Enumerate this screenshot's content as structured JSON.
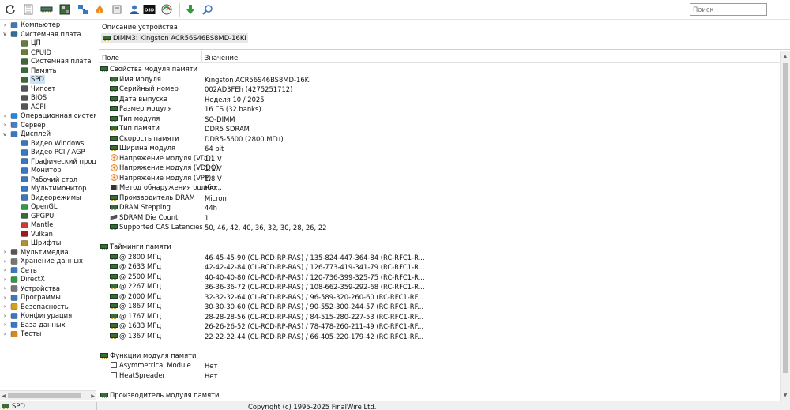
{
  "toolbar": {
    "search_placeholder": "Поиск",
    "icons": [
      "refresh-icon",
      "report-icon",
      "chip-icon",
      "motherboard-icon",
      "flame-icon",
      "network-icon",
      "user-icon",
      "osd-icon",
      "gauge-icon",
      "download-icon",
      "search-icon"
    ]
  },
  "tree": [
    {
      "label": "Компьютер",
      "level": 0,
      "expander": "›",
      "icon": "computer-icon",
      "color": "#3b78c4"
    },
    {
      "label": "Системная плата",
      "level": 0,
      "expander": "⌄",
      "icon": "motherboard-icon",
      "color": "#2f6f9f"
    },
    {
      "label": "ЦП",
      "level": 1,
      "icon": "cpu-icon",
      "color": "#6a7d3a"
    },
    {
      "label": "CPUID",
      "level": 1,
      "icon": "cpuid-icon",
      "color": "#6a7d3a"
    },
    {
      "label": "Системная плата",
      "level": 1,
      "icon": "motherboard-icon",
      "color": "#3a6b3a"
    },
    {
      "label": "Память",
      "level": 1,
      "icon": "memory-icon",
      "color": "#3a6b3a"
    },
    {
      "label": "SPD",
      "level": 1,
      "icon": "chip-icon",
      "color": "#3a6b3a",
      "selected": true
    },
    {
      "label": "Чипсет",
      "level": 1,
      "icon": "chipset-icon",
      "color": "#555"
    },
    {
      "label": "BIOS",
      "level": 1,
      "icon": "bios-icon",
      "color": "#555"
    },
    {
      "label": "ACPI",
      "level": 1,
      "icon": "acpi-icon",
      "color": "#555"
    },
    {
      "label": "Операционная система",
      "level": 0,
      "expander": "›",
      "icon": "windows-icon",
      "color": "#1e88e5"
    },
    {
      "label": "Сервер",
      "level": 0,
      "expander": "›",
      "icon": "server-icon",
      "color": "#4a7fbf"
    },
    {
      "label": "Дисплей",
      "level": 0,
      "expander": "⌄",
      "icon": "display-icon",
      "color": "#3b78c4"
    },
    {
      "label": "Видео Windows",
      "level": 1,
      "icon": "video-windows-icon",
      "color": "#3b78c4"
    },
    {
      "label": "Видео PCI / AGP",
      "level": 1,
      "icon": "video-pci-icon",
      "color": "#3b78c4"
    },
    {
      "label": "Графический процессо",
      "level": 1,
      "icon": "gpu-icon",
      "color": "#3b78c4"
    },
    {
      "label": "Монитор",
      "level": 1,
      "icon": "monitor-icon",
      "color": "#3b78c4"
    },
    {
      "label": "Рабочий стол",
      "level": 1,
      "icon": "desktop-icon",
      "color": "#3b78c4"
    },
    {
      "label": "Мультимонитор",
      "level": 1,
      "icon": "multimonitor-icon",
      "color": "#3b78c4"
    },
    {
      "label": "Видеорежимы",
      "level": 1,
      "icon": "videomodes-icon",
      "color": "#3b78c4"
    },
    {
      "label": "OpenGL",
      "level": 1,
      "icon": "opengl-icon",
      "color": "#2e9e3e"
    },
    {
      "label": "GPGPU",
      "level": 1,
      "icon": "gpgpu-icon",
      "color": "#3a6b3a"
    },
    {
      "label": "Mantle",
      "level": 1,
      "icon": "mantle-icon",
      "color": "#d33a2c"
    },
    {
      "label": "Vulkan",
      "level": 1,
      "icon": "vulkan-icon",
      "color": "#a01c1c"
    },
    {
      "label": "Шрифты",
      "level": 1,
      "icon": "fonts-icon",
      "color": "#b89020"
    },
    {
      "label": "Мультимедиа",
      "level": 0,
      "expander": "›",
      "icon": "multimedia-icon",
      "color": "#555"
    },
    {
      "label": "Хранение данных",
      "level": 0,
      "expander": "›",
      "icon": "storage-icon",
      "color": "#777"
    },
    {
      "label": "Сеть",
      "level": 0,
      "expander": "›",
      "icon": "network-icon",
      "color": "#3b78c4"
    },
    {
      "label": "DirectX",
      "level": 0,
      "expander": "›",
      "icon": "directx-icon",
      "color": "#2e9e3e"
    },
    {
      "label": "Устройства",
      "level": 0,
      "expander": "›",
      "icon": "devices-icon",
      "color": "#777"
    },
    {
      "label": "Программы",
      "level": 0,
      "expander": "›",
      "icon": "programs-icon",
      "color": "#3b78c4"
    },
    {
      "label": "Безопасность",
      "level": 0,
      "expander": "›",
      "icon": "security-icon",
      "color": "#d3a020"
    },
    {
      "label": "Конфигурация",
      "level": 0,
      "expander": "›",
      "icon": "configuration-icon",
      "color": "#3b78c4"
    },
    {
      "label": "База данных",
      "level": 0,
      "expander": "›",
      "icon": "database-icon",
      "color": "#3b78c4"
    },
    {
      "label": "Тесты",
      "level": 0,
      "expander": "›",
      "icon": "tests-icon",
      "color": "#d38a20"
    }
  ],
  "description": {
    "header": "Описание устройства",
    "value": "DIMM3: Kingston ACR56S46BS8MD-16KI"
  },
  "list": {
    "col_field": "Поле",
    "col_value": "Значение",
    "rows": [
      {
        "type": "group",
        "field": "Свойства модуля памяти",
        "icon": "chip"
      },
      {
        "field": "Имя модуля",
        "value": "Kingston ACR56S46BS8MD-16KI",
        "icon": "chip"
      },
      {
        "field": "Серийный номер",
        "value": "002AD3FEh (4275251712)",
        "icon": "chip"
      },
      {
        "field": "Дата выпуска",
        "value": "Неделя 10 / 2025",
        "icon": "chip"
      },
      {
        "field": "Размер модуля",
        "value": "16 ГБ (32 banks)",
        "icon": "chip"
      },
      {
        "field": "Тип модуля",
        "value": "SO-DIMM",
        "icon": "chip"
      },
      {
        "field": "Тип памяти",
        "value": "DDR5 SDRAM",
        "icon": "chip"
      },
      {
        "field": "Скорость памяти",
        "value": "DDR5-5600 (2800 МГц)",
        "icon": "chip"
      },
      {
        "field": "Ширина модуля",
        "value": "64 bit",
        "icon": "chip"
      },
      {
        "field": "Напряжение модуля (VDD)",
        "value": "1.1 V",
        "icon": "voltage"
      },
      {
        "field": "Напряжение модуля (VDDQ)",
        "value": "1.1 V",
        "icon": "voltage"
      },
      {
        "field": "Напряжение модуля (VPP)",
        "value": "1.8 V",
        "icon": "voltage"
      },
      {
        "field": "Метод обнаружения ошибо...",
        "value": "Нет",
        "icon": "chip-dark"
      },
      {
        "field": "Производитель DRAM",
        "value": "Micron",
        "icon": "chip"
      },
      {
        "field": "DRAM Stepping",
        "value": "44h",
        "icon": "chip"
      },
      {
        "field": "SDRAM Die Count",
        "value": "1",
        "icon": "die"
      },
      {
        "field": "Supported CAS Latencies",
        "value": "50, 46, 42, 40, 36, 32, 30, 28, 26, 22",
        "icon": "chip"
      },
      {
        "type": "blank"
      },
      {
        "type": "group",
        "field": "Тайминги памяти",
        "icon": "chip"
      },
      {
        "field": "@ 2800 МГц",
        "value": "46-45-45-90  (CL-RCD-RP-RAS) / 135-824-447-364-84  (RC-RFC1-R...",
        "icon": "chip"
      },
      {
        "field": "@ 2633 МГц",
        "value": "42-42-42-84  (CL-RCD-RP-RAS) / 126-773-419-341-79  (RC-RFC1-R...",
        "icon": "chip"
      },
      {
        "field": "@ 2500 МГц",
        "value": "40-40-40-80  (CL-RCD-RP-RAS) / 120-736-399-325-75  (RC-RFC1-R...",
        "icon": "chip"
      },
      {
        "field": "@ 2267 МГц",
        "value": "36-36-36-72  (CL-RCD-RP-RAS) / 108-662-359-292-68  (RC-RFC1-R...",
        "icon": "chip"
      },
      {
        "field": "@ 2000 МГц",
        "value": "32-32-32-64  (CL-RCD-RP-RAS) / 96-589-320-260-60  (RC-RFC1-RF...",
        "icon": "chip"
      },
      {
        "field": "@ 1867 МГц",
        "value": "30-30-30-60  (CL-RCD-RP-RAS) / 90-552-300-244-57  (RC-RFC1-RF...",
        "icon": "chip"
      },
      {
        "field": "@ 1767 МГц",
        "value": "28-28-28-56  (CL-RCD-RP-RAS) / 84-515-280-227-53  (RC-RFC1-RF...",
        "icon": "chip"
      },
      {
        "field": "@ 1633 МГц",
        "value": "26-26-26-52  (CL-RCD-RP-RAS) / 78-478-260-211-49  (RC-RFC1-RF...",
        "icon": "chip"
      },
      {
        "field": "@ 1367 МГц",
        "value": "22-22-22-44  (CL-RCD-RP-RAS) / 66-405-220-179-42  (RC-RFC1-RF...",
        "icon": "chip"
      },
      {
        "type": "blank"
      },
      {
        "type": "group",
        "field": "Функции модуля памяти",
        "icon": "chip"
      },
      {
        "field": "Asymmetrical Module",
        "value": "Нет",
        "icon": "checkbox"
      },
      {
        "field": "HeatSpreader",
        "value": "Нет",
        "icon": "checkbox"
      },
      {
        "type": "blank"
      },
      {
        "type": "group",
        "field": "Производитель модуля памяти",
        "icon": "chip"
      }
    ]
  },
  "status": {
    "left": "SPD",
    "copyright": "Copyright (c) 1995-2025 FinalWire Ltd."
  }
}
